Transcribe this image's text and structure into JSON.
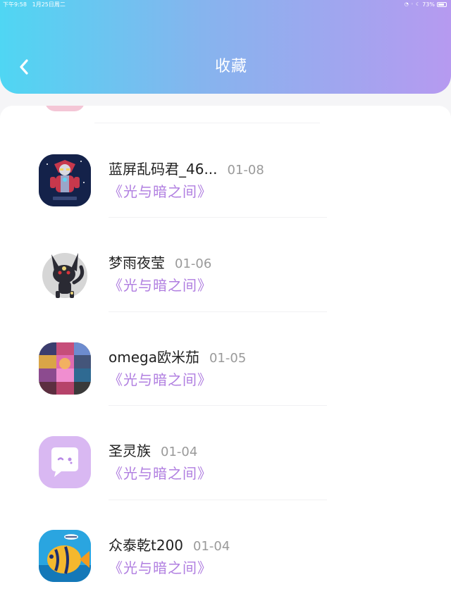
{
  "status_bar": {
    "time": "下午9:58",
    "date": "1月25日周二",
    "battery": "73%"
  },
  "header": {
    "title": "收藏"
  },
  "favorites": [
    {
      "name": "蓝屏乱码君_46...",
      "date": "01-08",
      "work": "《光与暗之间》",
      "avatar_icon": "ultraman-avatar"
    },
    {
      "name": "梦雨夜莹",
      "date": "01-06",
      "work": "《光与暗之间》",
      "avatar_icon": "umbreon-avatar"
    },
    {
      "name": "omega欧米茄",
      "date": "01-05",
      "work": "《光与暗之间》",
      "avatar_icon": "collage-avatar"
    },
    {
      "name": "圣灵族",
      "date": "01-04",
      "work": "《光与暗之间》",
      "avatar_icon": "chat-bubble-avatar"
    },
    {
      "name": "众泰乾t200",
      "date": "01-04",
      "work": "《光与暗之间》",
      "avatar_icon": "fish-avatar"
    }
  ],
  "colors": {
    "header_gradient_start": "#4fd6f3",
    "header_gradient_end": "#b69af0",
    "work_title": "#b07ee0",
    "date_text": "#9a9a9a",
    "default_avatar_bg": "#d9b8f2"
  }
}
